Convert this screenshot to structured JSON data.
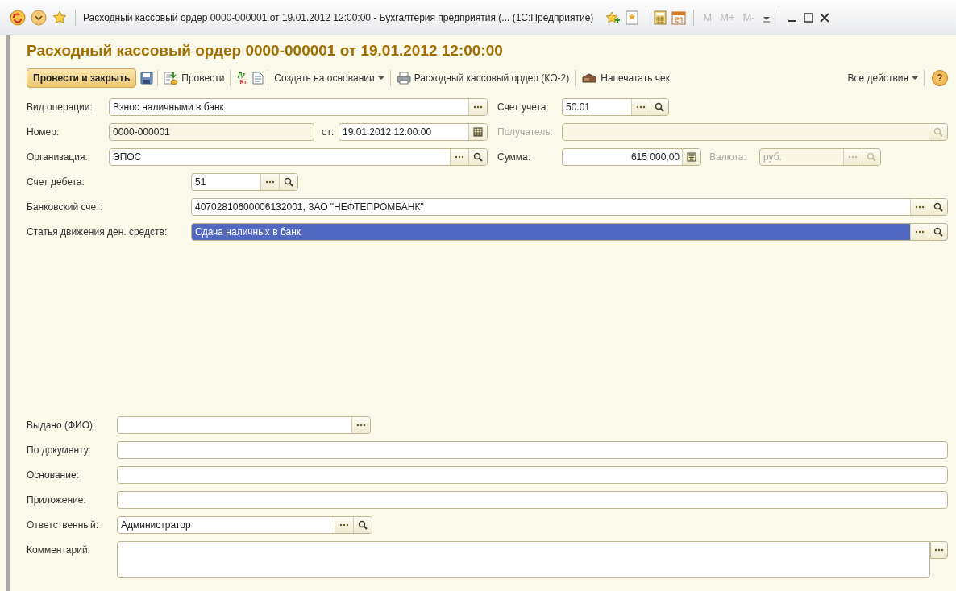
{
  "window": {
    "title": "Расходный кассовый ордер 0000-000001 от 19.01.2012 12:00:00 - Бухгалтерия предприятия (... (1С:Предприятие)",
    "memory_buttons": [
      {
        "label": "M",
        "disabled": true
      },
      {
        "label": "M+",
        "disabled": true
      },
      {
        "label": "M-",
        "disabled": true
      }
    ]
  },
  "heading": "Расходный кассовый ордер 0000-000001 от 19.01.2012 12:00:00",
  "toolbar": {
    "primary": "Провести и закрыть",
    "post": "Провести",
    "debit": "Дт",
    "credit": "Кт",
    "create_based": "Создать на основании",
    "print_form": "Расходный кассовый ордер (КО-2)",
    "print_receipt": "Напечатать чек",
    "all_actions": "Все действия",
    "help": "?"
  },
  "fields": [
    {
      "label": "Вид операции:",
      "value": "Взнос наличными в банк",
      "kind": "text",
      "disabled": false,
      "readonly": false,
      "selected": false,
      "buttons": [
        {
          "kind": "choose"
        }
      ]
    },
    {
      "label": "Счет учета:",
      "value": "50.01",
      "kind": "text",
      "disabled": false,
      "readonly": false,
      "selected": false,
      "buttons": [
        {
          "kind": "choose"
        },
        {
          "kind": "search"
        }
      ]
    },
    {
      "label": "Номер:",
      "value": "0000-000001",
      "kind": "text",
      "disabled": false,
      "readonly": true,
      "selected": false
    },
    {
      "label": "от:",
      "value": "19.01.2012 12:00:00",
      "kind": "text",
      "disabled": false,
      "readonly": false,
      "selected": false,
      "buttons": [
        {
          "kind": "calendar"
        }
      ]
    },
    {
      "label": "Получатель:",
      "kind": "text",
      "disabled": true,
      "readonly": false,
      "selected": false,
      "buttons": [
        {
          "kind": "search"
        }
      ]
    },
    {
      "label": "Организация:",
      "value": "ЭПОС",
      "kind": "text",
      "disabled": false,
      "readonly": false,
      "selected": false,
      "buttons": [
        {
          "kind": "choose"
        },
        {
          "kind": "search"
        }
      ]
    },
    {
      "label": "Сумма:",
      "value": "615 000,00",
      "kind": "number",
      "disabled": false,
      "readonly": false,
      "selected": false,
      "buttons": [
        {
          "kind": "calculator"
        }
      ]
    },
    {
      "label": "Валюта:",
      "value": "руб.",
      "kind": "text",
      "disabled": true,
      "readonly": false,
      "selected": false,
      "buttons": [
        {
          "kind": "choose"
        },
        {
          "kind": "search"
        }
      ]
    },
    {
      "label": "Счет дебета:",
      "value": "51",
      "kind": "text",
      "disabled": false,
      "readonly": false,
      "selected": false,
      "buttons": [
        {
          "kind": "choose"
        },
        {
          "kind": "search"
        }
      ]
    },
    {
      "label": "Банковский счет:",
      "value": "40702810600006132001, ЗАО \"НЕФТЕПРОМБАНК\"",
      "kind": "text",
      "disabled": false,
      "readonly": false,
      "selected": false,
      "buttons": [
        {
          "kind": "choose"
        },
        {
          "kind": "search"
        }
      ]
    },
    {
      "label": "Статья движения ден. средств:",
      "value": "Сдача наличных в банк",
      "kind": "text",
      "disabled": false,
      "readonly": false,
      "selected": true,
      "buttons": [
        {
          "kind": "choose"
        },
        {
          "kind": "search"
        }
      ]
    },
    {
      "label": "Выдано (ФИО):",
      "kind": "text",
      "disabled": false,
      "readonly": false,
      "selected": false,
      "buttons": [
        {
          "kind": "choose"
        }
      ]
    },
    {
      "label": "По документу:",
      "kind": "text",
      "disabled": false,
      "readonly": false,
      "selected": false
    },
    {
      "label": "Основание:",
      "kind": "text",
      "disabled": false,
      "readonly": false,
      "selected": false
    },
    {
      "label": "Приложение:",
      "kind": "text",
      "disabled": false,
      "readonly": false,
      "selected": false
    },
    {
      "label": "Ответственный:",
      "value": "Администратор",
      "kind": "text",
      "disabled": false,
      "readonly": false,
      "selected": false,
      "buttons": [
        {
          "kind": "choose"
        },
        {
          "kind": "search"
        }
      ]
    },
    {
      "label": "Комментарий:",
      "kind": "memo",
      "disabled": false,
      "readonly": false,
      "selected": false,
      "buttons": [
        {
          "kind": "choose"
        }
      ]
    }
  ]
}
